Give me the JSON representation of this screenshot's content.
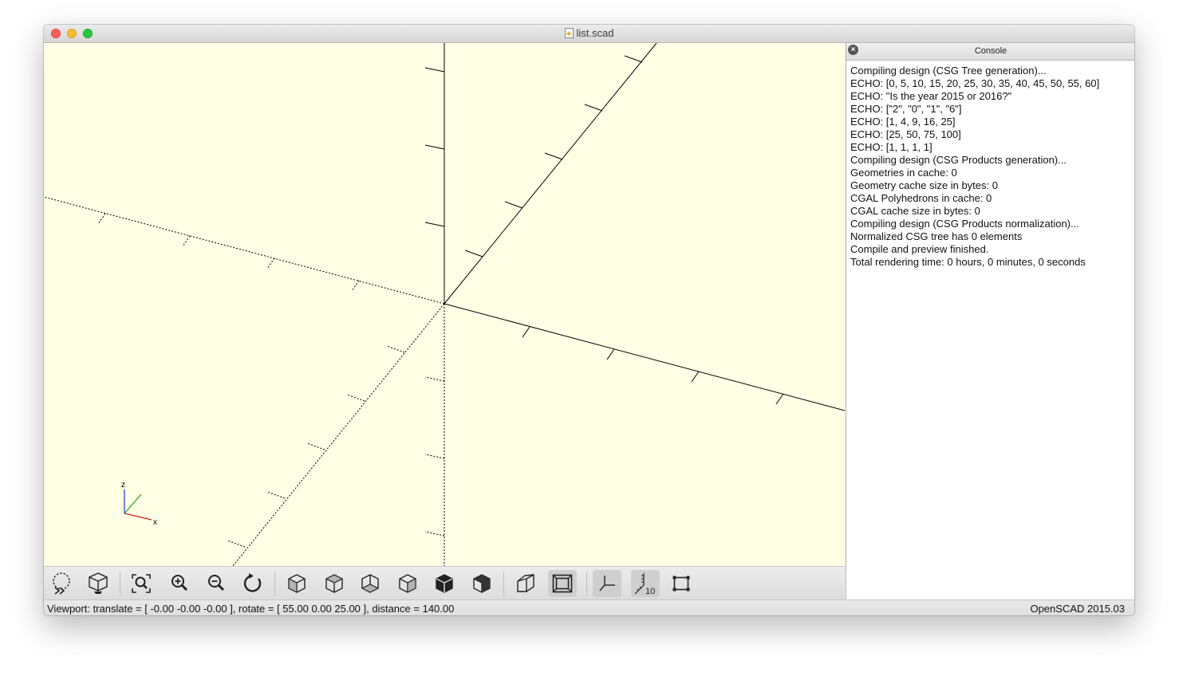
{
  "window": {
    "title": "list.scad"
  },
  "console": {
    "title": "Console",
    "lines": [
      "Compiling design (CSG Tree generation)...",
      "ECHO: [0, 5, 10, 15, 20, 25, 30, 35, 40, 45, 50, 55, 60]",
      "ECHO: \"Is the year 2015 or 2016?\"",
      "ECHO: [\"2\", \"0\", \"1\", \"6\"]",
      "ECHO: [1, 4, 9, 16, 25]",
      "ECHO: [25, 50, 75, 100]",
      "ECHO: [1, 1, 1, 1]",
      "Compiling design (CSG Products generation)...",
      "Geometries in cache: 0",
      "Geometry cache size in bytes: 0",
      "CGAL Polyhedrons in cache: 0",
      "CGAL cache size in bytes: 0",
      "Compiling design (CSG Products normalization)...",
      "Normalized CSG tree has 0 elements",
      "Compile and preview finished.",
      "Total rendering time: 0 hours, 0 minutes, 0 seconds"
    ]
  },
  "axes_gizmo": {
    "z_label": "z",
    "x_label": "x"
  },
  "scale_marker_label": "10",
  "toolbar": {
    "buttons": [
      {
        "name": "preview-button",
        "icon": "preview-icon"
      },
      {
        "name": "render-button",
        "icon": "render-icon"
      },
      {
        "name": "view-all-button",
        "icon": "zoom-fit-icon"
      },
      {
        "name": "zoom-in-button",
        "icon": "zoom-in-icon"
      },
      {
        "name": "zoom-out-button",
        "icon": "zoom-out-icon"
      },
      {
        "name": "reset-view-button",
        "icon": "reset-view-icon"
      },
      {
        "name": "view-right-button",
        "icon": "cube-right-icon"
      },
      {
        "name": "view-top-button",
        "icon": "cube-top-icon"
      },
      {
        "name": "view-bottom-button",
        "icon": "cube-bottom-icon"
      },
      {
        "name": "view-left-button",
        "icon": "cube-left-icon"
      },
      {
        "name": "view-front-button",
        "icon": "cube-front-icon"
      },
      {
        "name": "view-back-button",
        "icon": "cube-back-icon"
      },
      {
        "name": "perspective-button",
        "icon": "perspective-icon"
      },
      {
        "name": "orthogonal-button",
        "icon": "orthogonal-icon",
        "active": true
      },
      {
        "name": "show-axes-button",
        "icon": "axes-icon",
        "active": true
      },
      {
        "name": "show-scale-markers-button",
        "icon": "scale-markers-icon",
        "active": true
      },
      {
        "name": "show-edges-button",
        "icon": "edges-icon"
      }
    ]
  },
  "status": {
    "viewport": "Viewport: translate = [ -0.00 -0.00 -0.00 ], rotate = [ 55.00 0.00 25.00 ], distance = 140.00",
    "version": "OpenSCAD 2015.03"
  },
  "colors": {
    "viewport_bg": "#ffffe5",
    "axis": "#000000",
    "gizmo_x": "#d22020",
    "gizmo_y": "#20a020",
    "gizmo_z": "#2030d0"
  }
}
